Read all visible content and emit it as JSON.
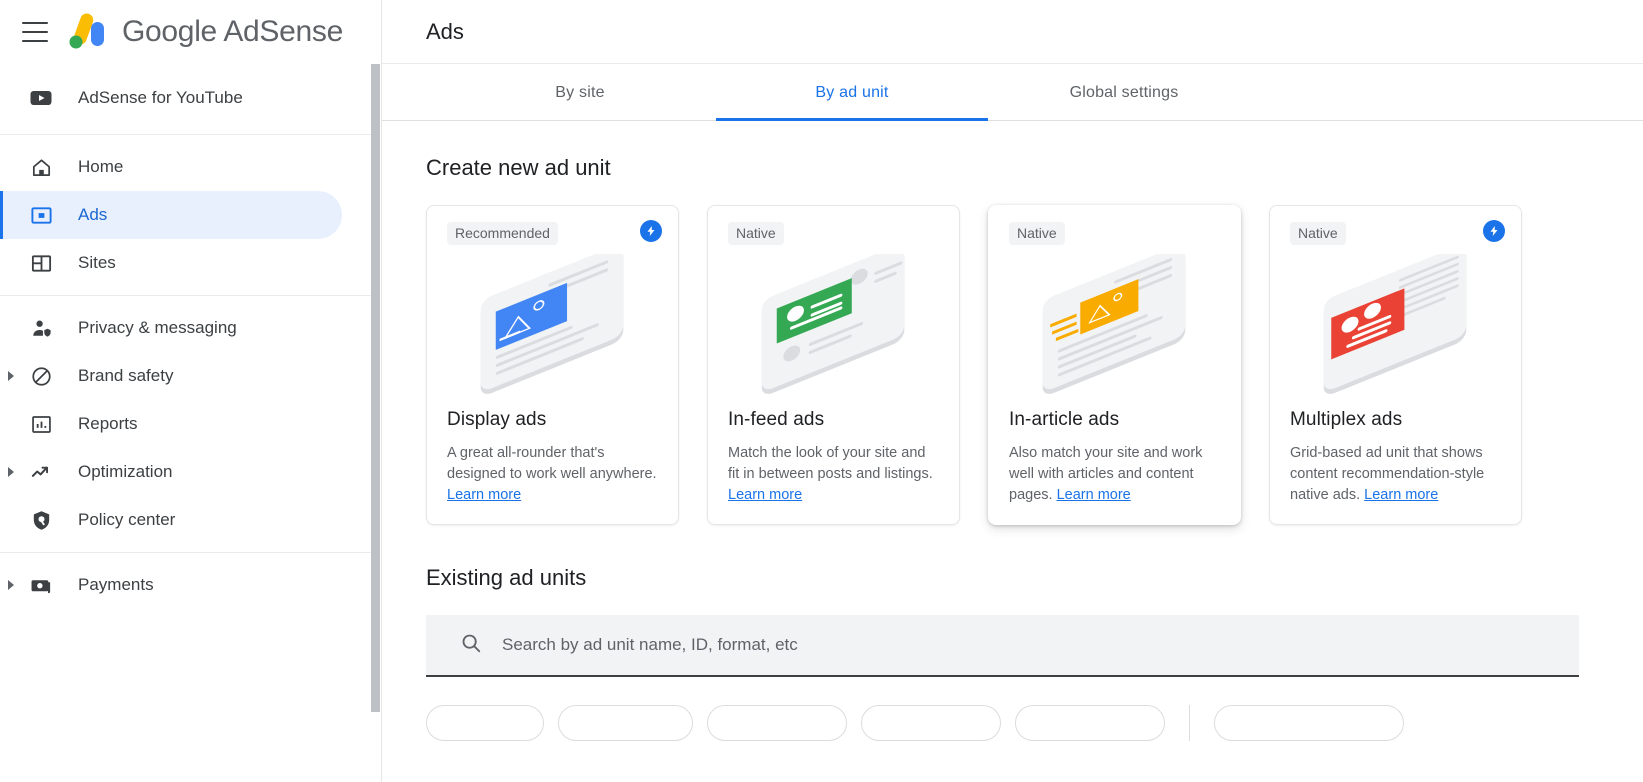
{
  "brand": {
    "logo_text": "Google AdSense",
    "menu_icon": "hamburger-menu-icon"
  },
  "sidebar": {
    "sections": [
      {
        "items": [
          {
            "label": "AdSense for YouTube",
            "icon": "youtube-icon",
            "expandable": false,
            "active": false
          }
        ]
      },
      {
        "items": [
          {
            "label": "Home",
            "icon": "home-icon",
            "expandable": false,
            "active": false
          },
          {
            "label": "Ads",
            "icon": "ads-icon",
            "expandable": false,
            "active": true
          },
          {
            "label": "Sites",
            "icon": "sites-icon",
            "expandable": false,
            "active": false
          }
        ]
      },
      {
        "items": [
          {
            "label": "Privacy & messaging",
            "icon": "person-shield-icon",
            "expandable": false,
            "active": false
          },
          {
            "label": "Brand safety",
            "icon": "block-circle-icon",
            "expandable": true,
            "active": false
          },
          {
            "label": "Reports",
            "icon": "bar-chart-icon",
            "expandable": false,
            "active": false
          },
          {
            "label": "Optimization",
            "icon": "trending-up-icon",
            "expandable": true,
            "active": false
          },
          {
            "label": "Policy center",
            "icon": "policy-shield-icon",
            "expandable": false,
            "active": false
          }
        ]
      },
      {
        "items": [
          {
            "label": "Payments",
            "icon": "payments-icon",
            "expandable": true,
            "active": false
          }
        ]
      }
    ]
  },
  "header": {
    "title": "Ads"
  },
  "tabs": [
    {
      "label": "By site",
      "selected": false
    },
    {
      "label": "By ad unit",
      "selected": true
    },
    {
      "label": "Global settings",
      "selected": false
    }
  ],
  "create_section": {
    "title": "Create new ad unit",
    "cards": [
      {
        "badge": "Recommended",
        "has_bolt": true,
        "bolt_icon": "bolt-icon",
        "title": "Display ads",
        "desc": "A great all-rounder that's designed to work well anywhere. ",
        "link": "Learn more",
        "illustration": "phone-display-ad-illustration",
        "accent": "#4285f4",
        "raised": false
      },
      {
        "badge": "Native",
        "has_bolt": false,
        "bolt_icon": "",
        "title": "In-feed ads",
        "desc": "Match the look of your site and fit in between posts and listings. ",
        "link": "Learn more",
        "illustration": "phone-infeed-ad-illustration",
        "accent": "#34a853",
        "raised": false
      },
      {
        "badge": "Native",
        "has_bolt": false,
        "bolt_icon": "",
        "title": "In-article ads",
        "desc": "Also match your site and work well with articles and content pages. ",
        "link": "Learn more",
        "illustration": "phone-inarticle-ad-illustration",
        "accent": "#f9ab00",
        "raised": true
      },
      {
        "badge": "Native",
        "has_bolt": true,
        "bolt_icon": "bolt-icon",
        "title": "Multiplex ads",
        "desc": "Grid-based ad unit that shows content recommendation-style native ads. ",
        "link": "Learn more",
        "illustration": "phone-multiplex-ad-illustration",
        "accent": "#ea4335",
        "raised": false
      }
    ]
  },
  "existing_section": {
    "title": "Existing ad units",
    "search": {
      "placeholder": "Search by ad unit name, ID, format, etc",
      "value": "",
      "icon": "search-icon"
    }
  },
  "colors": {
    "accent_blue": "#1a73e8",
    "active_bg": "#e8f0fe",
    "text_primary": "#202124",
    "text_secondary": "#5f6368",
    "chip_bg": "#f1f3f4",
    "search_bg": "#f1f3f4",
    "border": "#dadce0"
  }
}
